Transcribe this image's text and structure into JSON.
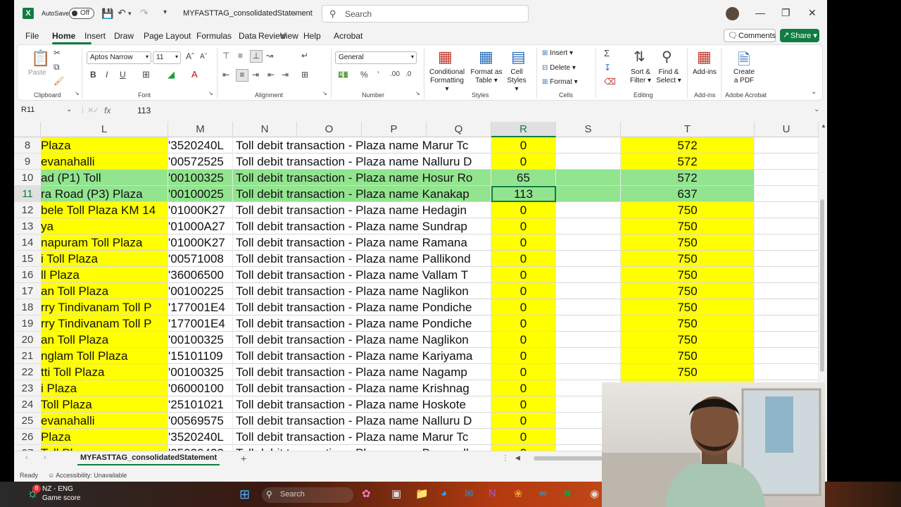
{
  "title_bar": {
    "logo": "X",
    "autosave_label": "AutoSave",
    "autosave_state": "Off",
    "file_name": "MYFASTTAG_consolidatedStatement",
    "search_placeholder": "Search"
  },
  "menu": {
    "items": [
      "File",
      "Home",
      "Insert",
      "Draw",
      "Page Layout",
      "Formulas",
      "Data",
      "Review",
      "View",
      "Help",
      "Acrobat"
    ],
    "active": "Home",
    "comments_label": "Comments",
    "share_label": "Share"
  },
  "ribbon": {
    "clipboard": {
      "paste": "Paste",
      "label": "Clipboard"
    },
    "font": {
      "name": "Aptos Narrow",
      "size": "11",
      "label": "Font"
    },
    "alignment": {
      "label": "Alignment"
    },
    "number": {
      "format": "General",
      "label": "Number"
    },
    "styles": {
      "conditional": "Conditional",
      "formatting": "Formatting",
      "format_as": "Format as",
      "table": "Table",
      "cell": "Cell",
      "styles_word": "Styles",
      "label": "Styles"
    },
    "cells": {
      "insert": "Insert",
      "delete": "Delete",
      "format": "Format",
      "label": "Cells"
    },
    "editing": {
      "sort": "Sort &",
      "filter": "Filter",
      "find": "Find &",
      "select": "Select",
      "label": "Editing"
    },
    "addins": {
      "addins": "Add-ins",
      "label": "Add-ins"
    },
    "acrobat": {
      "create": "Create",
      "pdf": "a PDF",
      "label": "Adobe Acrobat"
    }
  },
  "formula_bar": {
    "name_box": "R11",
    "fx": "fx",
    "value": "113"
  },
  "columns": [
    "L",
    "M",
    "N",
    "O",
    "P",
    "Q",
    "R",
    "S",
    "T",
    "U"
  ],
  "selected_column": "R",
  "rows": [
    {
      "n": "8",
      "l": " Plaza",
      "m": "'3520240L",
      "np": "Toll debit transaction - Plaza name Marur Tc",
      "r": "0",
      "t": "572",
      "hl": "y"
    },
    {
      "n": "9",
      "l": "evanahalli",
      "m": "'00572525",
      "np": "Toll debit transaction - Plaza name Nalluru D",
      "r": "0",
      "t": "572",
      "hl": "y"
    },
    {
      "n": "10",
      "l": "ad (P1) Toll",
      "m": "'00100325",
      "np": "Toll debit transaction - Plaza name Hosur Ro",
      "r": "65",
      "t": "572",
      "hl": "g"
    },
    {
      "n": "11",
      "l": "ra Road (P3) Plaza",
      "m": "'00100025",
      "np": "Toll debit transaction - Plaza name Kanakap",
      "r": "113",
      "t": "637",
      "hl": "g"
    },
    {
      "n": "12",
      "l": "bele Toll Plaza KM 14",
      "m": "'01000K27",
      "np": "Toll debit transaction - Plaza name Hedagin",
      "r": "0",
      "t": "750",
      "hl": "y"
    },
    {
      "n": "13",
      "l": "ya",
      "m": "'01000A27",
      "np": "Toll debit transaction - Plaza name Sundrap",
      "r": "0",
      "t": "750",
      "hl": "y"
    },
    {
      "n": "14",
      "l": "napuram Toll Plaza",
      "m": "'01000K27",
      "np": "Toll debit transaction - Plaza name Ramana",
      "r": "0",
      "t": "750",
      "hl": "y"
    },
    {
      "n": "15",
      "l": "i Toll Plaza",
      "m": "'00571008",
      "np": "Toll debit transaction - Plaza name Pallikond",
      "r": "0",
      "t": "750",
      "hl": "y"
    },
    {
      "n": "16",
      "l": "ll Plaza",
      "m": "'36006500",
      "np": "Toll debit transaction - Plaza name Vallam T",
      "r": "0",
      "t": "750",
      "hl": "y"
    },
    {
      "n": "17",
      "l": "an Toll Plaza",
      "m": "'00100225",
      "np": "Toll debit transaction - Plaza name Naglikon",
      "r": "0",
      "t": "750",
      "hl": "y"
    },
    {
      "n": "18",
      "l": "rry Tindivanam Toll P",
      "m": "'177001E4",
      "np": "Toll debit transaction - Plaza name Pondiche",
      "r": "0",
      "t": "750",
      "hl": "y"
    },
    {
      "n": "19",
      "l": "rry Tindivanam Toll P",
      "m": "'177001E4",
      "np": "Toll debit transaction - Plaza name Pondiche",
      "r": "0",
      "t": "750",
      "hl": "y"
    },
    {
      "n": "20",
      "l": "an Toll Plaza",
      "m": "'00100325",
      "np": "Toll debit transaction - Plaza name Naglikon",
      "r": "0",
      "t": "750",
      "hl": "y"
    },
    {
      "n": "21",
      "l": "nglam Toll Plaza",
      "m": "'15101109",
      "np": "Toll debit transaction - Plaza name Kariyama",
      "r": "0",
      "t": "750",
      "hl": "y"
    },
    {
      "n": "22",
      "l": "tti Toll Plaza",
      "m": "'00100325",
      "np": "Toll debit transaction - Plaza name Nagamp",
      "r": "0",
      "t": "750",
      "hl": "y"
    },
    {
      "n": "23",
      "l": "i Plaza",
      "m": "'06000100",
      "np": "Toll debit transaction - Plaza name Krishnag",
      "r": "0",
      "t": "750",
      "hl": "y"
    },
    {
      "n": "24",
      "l": "Toll Plaza",
      "m": "'25101021",
      "np": "Toll debit transaction - Plaza name Hoskote",
      "r": "0",
      "t": "",
      "hl": "y"
    },
    {
      "n": "25",
      "l": "evanahalli",
      "m": "'00569575",
      "np": "Toll debit transaction - Plaza name Nalluru D",
      "r": "0",
      "t": "",
      "hl": "y"
    },
    {
      "n": "26",
      "l": " Plaza",
      "m": "'3520240L",
      "np": "Toll debit transaction - Plaza name Marur Tc",
      "r": "0",
      "t": "",
      "hl": "y"
    },
    {
      "n": "27",
      "l": "Toll Plaza",
      "m": "'25030433",
      "np": "Toll debit transaction - Plaza name Bagepall",
      "r": "0",
      "t": "",
      "hl": "y"
    }
  ],
  "sheet_tab": "MYFASTTAG_consolidatedStatement",
  "status": {
    "ready": "Ready",
    "accessibility": "Accessibility: Unavailable"
  },
  "taskbar": {
    "badge": "8",
    "weather_line1": "NZ - ENG",
    "weather_line2": "Game score",
    "search": "Search"
  },
  "colors": {
    "yellow": "#ffff00",
    "green": "#92e48f",
    "excel_green": "#107c41"
  }
}
